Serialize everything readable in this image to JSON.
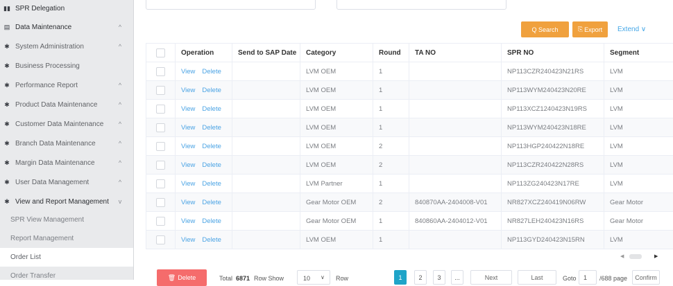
{
  "sidebar": {
    "items": [
      {
        "label": "SPR Delegation",
        "arrow": ""
      },
      {
        "label": "Data Maintenance",
        "arrow": "^"
      },
      {
        "label": "System Administration",
        "arrow": "^"
      },
      {
        "label": "Business Processing",
        "arrow": ""
      },
      {
        "label": "Performance Report",
        "arrow": "^"
      },
      {
        "label": "Product Data Maintenance",
        "arrow": "^"
      },
      {
        "label": "Customer Data Maintenance",
        "arrow": "^"
      },
      {
        "label": "Branch Data Maintenance",
        "arrow": "^"
      },
      {
        "label": "Margin Data Maintenance",
        "arrow": "^"
      },
      {
        "label": "User Data Management",
        "arrow": "^"
      },
      {
        "label": "View and Report Management",
        "arrow": "v"
      }
    ],
    "subitems": [
      "SPR View Management",
      "Report Management",
      "Order List",
      "Order Transfer"
    ]
  },
  "toolbar": {
    "search_label": "Q Search",
    "export_label": "Export",
    "extend_label": "Extend ∨"
  },
  "table": {
    "headers": [
      "Operation",
      "Send to SAP Date",
      "Category",
      "Round",
      "TA NO",
      "SPR NO",
      "Segment"
    ],
    "view_label": "View",
    "delete_label": "Delete",
    "rows": [
      {
        "send_date": "",
        "category": "LVM OEM",
        "round": "1",
        "ta_no": "",
        "spr_no": "NP113CZR240423N21RS",
        "segment": "LVM"
      },
      {
        "send_date": "",
        "category": "LVM OEM",
        "round": "1",
        "ta_no": "",
        "spr_no": "NP113WYM240423N20RE",
        "segment": "LVM"
      },
      {
        "send_date": "",
        "category": "LVM OEM",
        "round": "1",
        "ta_no": "",
        "spr_no": "NP113XCZ1240423N19RS",
        "segment": "LVM"
      },
      {
        "send_date": "",
        "category": "LVM OEM",
        "round": "1",
        "ta_no": "",
        "spr_no": "NP113WYM240423N18RE",
        "segment": "LVM"
      },
      {
        "send_date": "",
        "category": "LVM OEM",
        "round": "2",
        "ta_no": "",
        "spr_no": "NP113HGP240422N18RE",
        "segment": "LVM"
      },
      {
        "send_date": "",
        "category": "LVM OEM",
        "round": "2",
        "ta_no": "",
        "spr_no": "NP113CZR240422N28RS",
        "segment": "LVM"
      },
      {
        "send_date": "",
        "category": "LVM Partner",
        "round": "1",
        "ta_no": "",
        "spr_no": "NP113ZG240423N17RE",
        "segment": "LVM"
      },
      {
        "send_date": "",
        "category": "Gear Motor OEM",
        "round": "2",
        "ta_no": "840870AA-2404008-V01",
        "spr_no": "NR827XCZ240419N06RW",
        "segment": "Gear Motor"
      },
      {
        "send_date": "",
        "category": "Gear Motor OEM",
        "round": "1",
        "ta_no": "840860AA-2404012-V01",
        "spr_no": "NR827LEH240423N16RS",
        "segment": "Gear Motor"
      },
      {
        "send_date": "",
        "category": "LVM OEM",
        "round": "1",
        "ta_no": "",
        "spr_no": "NP113GYD240423N15RN",
        "segment": "LVM"
      }
    ]
  },
  "pagination": {
    "delete_label": "Delete",
    "total_prefix": "Total",
    "total": "6871",
    "row_show": "Row Show",
    "page_size": "10",
    "row_suffix": "Row",
    "pages": [
      "1",
      "2",
      "3",
      "..."
    ],
    "next": "Next",
    "last": "Last",
    "goto_label": "Goto",
    "goto_value": "1",
    "page_count": "/688 page",
    "confirm": "Confirm"
  },
  "colors": {
    "accent_orange": "#f0a13e",
    "link_blue": "#4aa3e4",
    "danger_red": "#f56c6c",
    "active_page": "#1fa4c8"
  },
  "icons": {
    "sidebar_first": "book-icon",
    "sidebar_second": "document-icon",
    "sidebar_rest": "gear-icon"
  }
}
